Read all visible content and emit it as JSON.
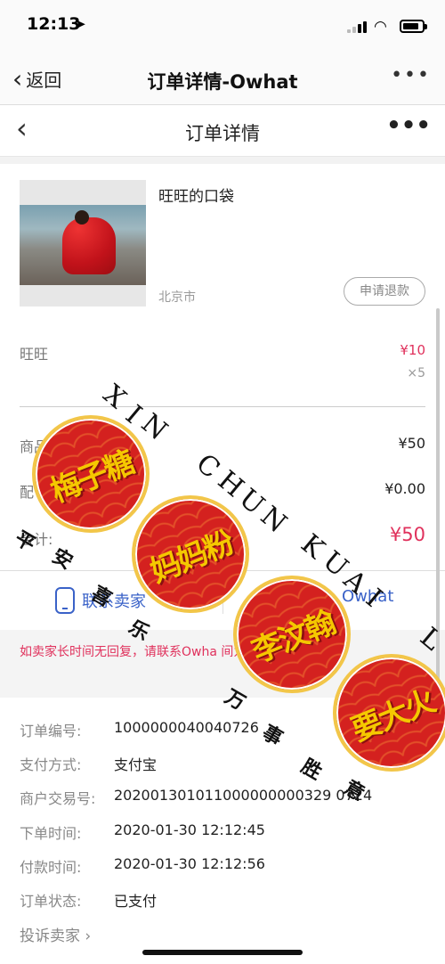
{
  "status_bar": {
    "time": "12:13",
    "location_arrow": "➤"
  },
  "outer_nav": {
    "back_label": "返回",
    "title": "订单详情-Owhat",
    "more": "•••"
  },
  "inner_nav": {
    "back": "‹",
    "title": "订单详情",
    "more": "•••"
  },
  "product": {
    "name": "旺旺的口袋",
    "city": "北京市",
    "refund_label": "申请退款"
  },
  "item": {
    "name": "旺旺",
    "price": "¥10",
    "qty": "×5"
  },
  "summary": {
    "goods_label": "商品",
    "goods_value": "¥50",
    "shipping_label": "配",
    "shipping_value": "¥0.00",
    "total_label": "合计:",
    "total_value": "¥50"
  },
  "contact": {
    "seller_label": "联系卖家",
    "owhat_label": "Owhat"
  },
  "notice": {
    "text": "如卖家长时间无回复，请联系Owha          间为您解决订单问题。"
  },
  "order_info": [
    {
      "label": "订单编号:",
      "value": "1000000040040726"
    },
    {
      "label": "支付方式:",
      "value": "支付宝"
    },
    {
      "label": "商户交易号:",
      "value": "202001301011000000000329 0724"
    },
    {
      "label": "下单时间:",
      "value": "2020-01-30 12:12:45"
    },
    {
      "label": "付款时间:",
      "value": "2020-01-30 12:12:56"
    },
    {
      "label": "订单状态:",
      "value": "已支付"
    }
  ],
  "complain_label": "投诉卖家",
  "overlay": {
    "stamps": [
      "梅子糖",
      "妈妈粉",
      "李汶翰",
      "要大火"
    ],
    "latin": [
      "X",
      "I",
      "N",
      "C",
      "H",
      "U",
      "N",
      "K",
      "U",
      "A",
      "I",
      "L"
    ],
    "hanzi": [
      "万",
      "事",
      "胜",
      "意",
      "安",
      "喜",
      "乐",
      "平"
    ],
    "colors": {
      "stamp_red": "#d4211f",
      "stamp_gold": "#f5c800",
      "accent_pink": "#e0315c",
      "link_blue": "#3a62c8"
    }
  }
}
